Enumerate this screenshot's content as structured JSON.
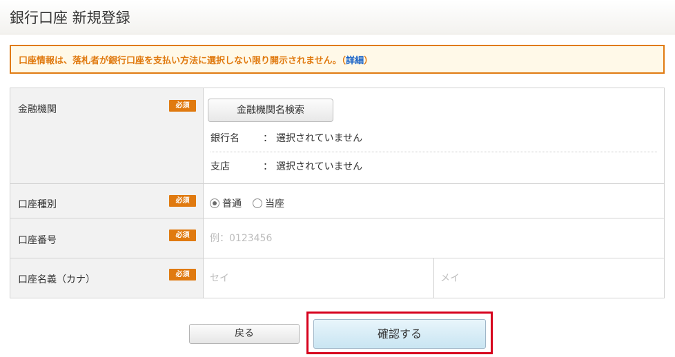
{
  "page": {
    "title": "銀行口座 新規登録"
  },
  "notice": {
    "text": "口座情報は、落札者が銀行口座を支払い方法に選択しない限り開示されません。（",
    "link": "詳細",
    "suffix": "）"
  },
  "form": {
    "required_badge": "必須",
    "bank": {
      "label": "金融機関",
      "search_button": "金融機関名検索",
      "bank_name_key": "銀行名",
      "branch_key": "支店",
      "colon": "：",
      "bank_name_value": "選択されていません",
      "branch_value": "選択されていません"
    },
    "account_type": {
      "label": "口座種別",
      "options": [
        "普通",
        "当座"
      ],
      "selected": "普通"
    },
    "account_number": {
      "label": "口座番号",
      "placeholder": "例：0123456"
    },
    "account_name": {
      "label": "口座名義（カナ）",
      "placeholder_last": "セイ",
      "placeholder_first": "メイ"
    }
  },
  "actions": {
    "back_label": "戻る",
    "confirm_label": "確認する",
    "highlight_color": "#d6001c"
  },
  "colors": {
    "accent_orange": "#e07a10",
    "link_blue": "#1560c6",
    "label_bg": "#f2f2f2"
  }
}
